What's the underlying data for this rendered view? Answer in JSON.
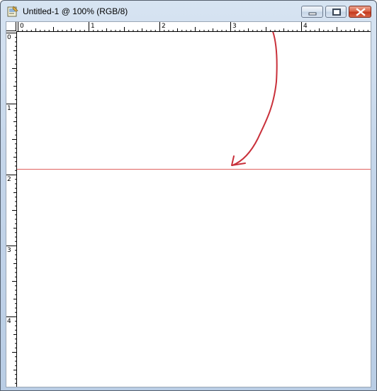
{
  "window": {
    "title": "Untitled-1 @ 100% (RGB/8)",
    "icon": "photoshop-document-icon",
    "controls": {
      "minimize": "minimize-icon",
      "maximize": "maximize-icon",
      "close": "close-icon"
    }
  },
  "rulers": {
    "horizontal_labels": [
      "0",
      "1",
      "2",
      "3",
      "4"
    ],
    "vertical_labels": [
      "0",
      "1",
      "2",
      "3",
      "4"
    ]
  },
  "canvas": {
    "background": "#ffffff",
    "guide_color": "#e0635f",
    "annotation_color": "#c9303a",
    "guide_position_units": 1.95
  }
}
